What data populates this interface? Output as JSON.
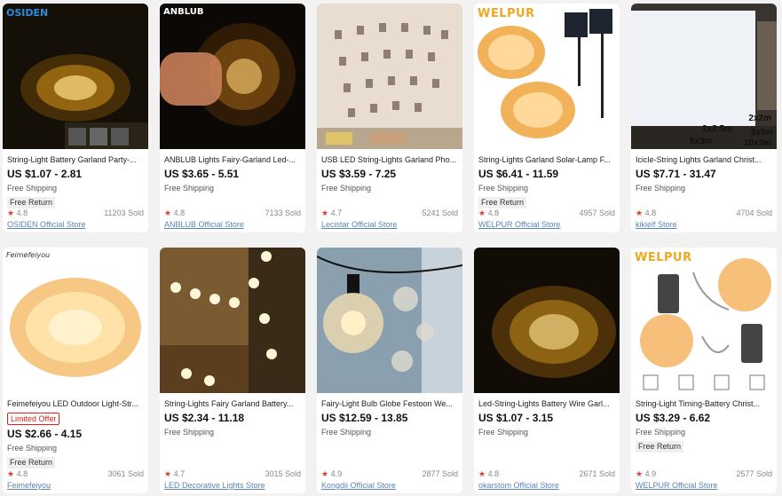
{
  "products": [
    {
      "brand": "OSIDEN",
      "title": "String-Light Battery Garland Party-...",
      "offer": "",
      "price": "US $1.07 - 2.81",
      "shipping": "Free Shipping",
      "return": "Free Return",
      "rating": "4.8",
      "sold": "11203 Sold",
      "store": "OSIDEN Official Store"
    },
    {
      "brand": "ANBLUB",
      "title": "ANBLUB Lights Fairy-Garland Led-...",
      "offer": "",
      "price": "US $3.65 - 5.51",
      "shipping": "Free Shipping",
      "return": "",
      "rating": "4.8",
      "sold": "7133 Sold",
      "store": "ANBLUB Official Store"
    },
    {
      "brand": "",
      "title": "USB LED String-Lights Garland Pho...",
      "offer": "",
      "price": "US $3.59 - 7.25",
      "shipping": "Free Shipping",
      "return": "",
      "rating": "4.7",
      "sold": "5241 Sold",
      "store": "Lecistar Official Store"
    },
    {
      "brand": "WELPUR",
      "title": "String-Lights Garland Solar-Lamp F...",
      "offer": "",
      "price": "US $6.41 - 11.59",
      "shipping": "Free Shipping",
      "return": "Free Return",
      "rating": "4.8",
      "sold": "4957 Sold",
      "store": "WELPUR Official Store"
    },
    {
      "brand": "",
      "title": "Icicle-String Lights Garland Christ...",
      "offer": "",
      "price": "US $7.71 - 31.47",
      "shipping": "Free Shipping",
      "return": "",
      "rating": "4.8",
      "sold": "4704 Sold",
      "store": "kikielf Store",
      "sizes": [
        "2x2m",
        "3x2.5m",
        "3x3m",
        "6x3m",
        "10x3m"
      ]
    },
    {
      "brand": "Feimefeiyou",
      "title": "Feimefeiyou LED Outdoor Light-Str...",
      "offer": "Limited Offer",
      "price": "US $2.66 - 4.15",
      "shipping": "Free Shipping",
      "return": "Free Return",
      "rating": "4.8",
      "sold": "3061 Sold",
      "store": "Feimefeiyou"
    },
    {
      "brand": "",
      "title": "String-Lights Fairy Garland Battery...",
      "offer": "",
      "price": "US $2.34 - 11.18",
      "shipping": "Free Shipping",
      "return": "",
      "rating": "4.7",
      "sold": "3015 Sold",
      "store": "LED Decorative Lights Store"
    },
    {
      "brand": "",
      "title": "Fairy-Light Bulb Globe Festoon We...",
      "offer": "",
      "price": "US $12.59 - 13.85",
      "shipping": "Free Shipping",
      "return": "",
      "rating": "4.9",
      "sold": "2877 Sold",
      "store": "Kongdii Official Store"
    },
    {
      "brand": "",
      "title": "Led-String-Lights Battery Wire Garl...",
      "offer": "",
      "price": "US $1.07 - 3.15",
      "shipping": "Free Shipping",
      "return": "",
      "rating": "4.8",
      "sold": "2671 Sold",
      "store": "okarstom Official Store"
    },
    {
      "brand": "WELPUR",
      "title": "String-Light Timing-Battery Christ...",
      "offer": "",
      "price": "US $3.29 - 6.62",
      "shipping": "Free Shipping",
      "return": "Free Return",
      "rating": "4.9",
      "sold": "2577 Sold",
      "store": "WELPUR Official Store"
    }
  ],
  "icons": {
    "star": "star-icon"
  },
  "colors": {
    "accent_red": "#e63a2e",
    "link_blue": "#5b84b6",
    "offer_red": "#e02020"
  }
}
